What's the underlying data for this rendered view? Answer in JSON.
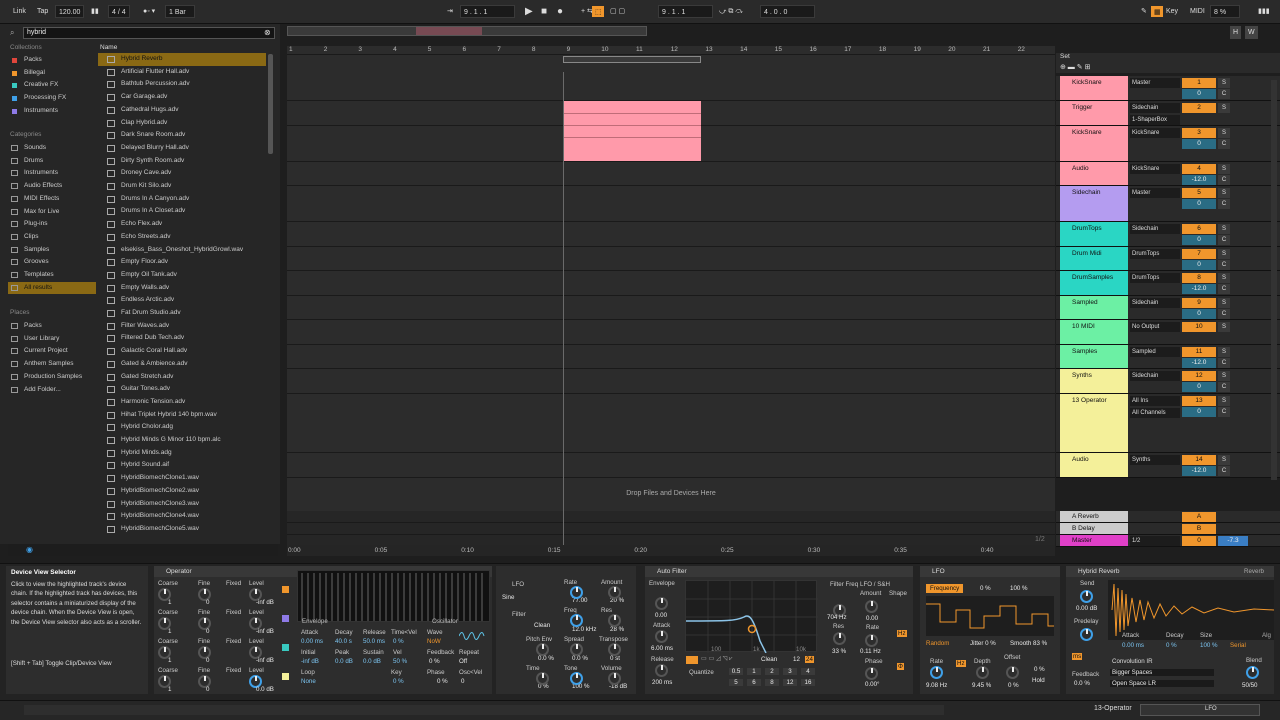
{
  "topbar": {
    "link": "Link",
    "tap": "Tap",
    "tempo": "120.00",
    "signature": "4 / 4",
    "quantize": "1 Bar",
    "position": "9 .  1 .  1",
    "loop_start": "9 .  1 .  1",
    "loop_length": "4 .  0 .  0",
    "key": "Key",
    "midi": "MIDI",
    "cpu": "8 %",
    "h": "H",
    "w": "W"
  },
  "browser": {
    "search_value": "hybrid",
    "collections_title": "Collections",
    "collections": [
      {
        "label": "Packs",
        "color": "#e0463c"
      },
      {
        "label": "Billegal",
        "color": "#f0962c"
      },
      {
        "label": "Creative FX",
        "color": "#39c9c0"
      },
      {
        "label": "Processing FX",
        "color": "#3fa0e8"
      },
      {
        "label": "Instruments",
        "color": "#8e7ae6"
      }
    ],
    "categories_title": "Categories",
    "categories": [
      "Sounds",
      "Drums",
      "Instruments",
      "Audio Effects",
      "MIDI Effects",
      "Max for Live",
      "Plug-ins",
      "Clips",
      "Samples",
      "Grooves",
      "Templates",
      "All results"
    ],
    "places_title": "Places",
    "places": [
      "Packs",
      "User Library",
      "Current Project",
      "Anthem Samples",
      "Production Samples",
      "Add Folder..."
    ],
    "name_header": "Name",
    "files": [
      "Hybrid Reverb",
      "Artificial Flutter Hall.adv",
      "Bathtub Percussion.adv",
      "Car Garage.adv",
      "Cathedral Hugs.adv",
      "Clap Hybrid.adv",
      "Dark Snare Room.adv",
      "Delayed Blurry Hall.adv",
      "Dirty Synth Room.adv",
      "Droney Cave.adv",
      "Drum Kit Silo.adv",
      "Drums In A Canyon.adv",
      "Drums In A Closet.adv",
      "Echo Flex.adv",
      "Echo Streets.adv",
      "elsekiss_Bass_Oneshot_HybridGrowl.wav",
      "Empty Floor.adv",
      "Empty Oil Tank.adv",
      "Empty Walls.adv",
      "Endless Arctic.adv",
      "Fat Drum Studio.adv",
      "Filter Waves.adv",
      "Filtered Dub Tech.adv",
      "Galactic Coral Hall.adv",
      "Gated & Ambience.adv",
      "Gated Stretch.adv",
      "Guitar Tones.adv",
      "Harmonic Tension.adv",
      "Hihat Triplet Hybrid 140 bpm.wav",
      "Hybrid Cholor.adg",
      "Hybrid Minds G Minor 110 bpm.alc",
      "Hybrid Minds.adg",
      "Hybrid Sound.aif",
      "HybridBiomechClone1.wav",
      "HybridBiomechClone2.wav",
      "HybridBiomechClone3.wav",
      "HybridBiomechClone4.wav",
      "HybridBiomechClone5.wav"
    ]
  },
  "arrangement": {
    "ruler": [
      "1",
      "2",
      "3",
      "4",
      "5",
      "6",
      "7",
      "8",
      "9",
      "10",
      "11",
      "12",
      "13",
      "14",
      "15",
      "16",
      "17",
      "18",
      "19",
      "20",
      "21",
      "22"
    ],
    "time": [
      "0:00",
      "0:05",
      "0:10",
      "0:15",
      "0:20",
      "0:25",
      "0:30",
      "0:35",
      "0:40"
    ],
    "drop_text": "Drop Files and Devices Here",
    "set_label": "Set",
    "zoom": "1/2"
  },
  "tracks": [
    {
      "name": "KickSnare",
      "color": "#ff9aaa",
      "io": "Master",
      "num": "1",
      "vol": "0",
      "h": 25
    },
    {
      "name": "Trigger",
      "color": "#ff9aaa",
      "io": "Sidechain",
      "io2": "1-ShaperBox",
      "num": "2",
      "vol": "",
      "h": 25
    },
    {
      "name": "KickSnare",
      "color": "#ff9aaa",
      "io": "KickSnare",
      "num": "3",
      "vol": "0",
      "h": 36
    },
    {
      "name": "Audio",
      "color": "#ff9aaa",
      "io": "KickSnare",
      "num": "4",
      "vol": "-12.0",
      "h": 24
    },
    {
      "name": "Sidechain",
      "color": "#b49cf0",
      "io": "Master",
      "num": "5",
      "vol": "0",
      "h": 36
    },
    {
      "name": "DrumTops",
      "color": "#2ad6c4",
      "io": "Sidechain",
      "num": "6",
      "vol": "0",
      "h": 25
    },
    {
      "name": "Drum Midi",
      "color": "#2ad6c4",
      "io": "DrumTops",
      "num": "7",
      "vol": "0",
      "h": 24
    },
    {
      "name": "DrumSamples",
      "color": "#2ad6c4",
      "io": "DrumTops",
      "num": "8",
      "vol": "-12.0",
      "h": 25
    },
    {
      "name": "Sampled",
      "color": "#6cf0a4",
      "io": "Sidechain",
      "num": "9",
      "vol": "0",
      "h": 24
    },
    {
      "name": "10 MIDI",
      "color": "#6cf0a4",
      "io": "No Output",
      "num": "10",
      "vol": "",
      "h": 25
    },
    {
      "name": "Samples",
      "color": "#6cf0a4",
      "io": "Sampled",
      "num": "11",
      "vol": "-12.0",
      "h": 24
    },
    {
      "name": "Synths",
      "color": "#f4f09a",
      "io": "Sidechain",
      "num": "12",
      "vol": "0",
      "h": 25
    },
    {
      "name": "13 Operator",
      "color": "#f4f09a",
      "io": "All Ins",
      "io2": "All Channels",
      "num": "13",
      "vol": "0",
      "h": 59
    },
    {
      "name": "Audio",
      "color": "#f4f09a",
      "io": "Synths",
      "num": "14",
      "vol": "-12.0",
      "h": 25
    }
  ],
  "returns": [
    {
      "name": "A Reverb",
      "num": "A",
      "color": "#cccccc"
    },
    {
      "name": "B Delay",
      "num": "B",
      "color": "#cccccc"
    },
    {
      "name": "Master",
      "num": "0",
      "vol": "-7.3",
      "io": "1/2",
      "color": "#e040c8"
    }
  ],
  "info": {
    "title": "Device View Selector",
    "body": "Click to view the highlighted track's device chain. If the highlighted track has devices, this selector contains a miniaturized display of the device chain. When the Device View is open, the Device View selector also acts as a scroller.",
    "shortcut": "[Shift + Tab] Toggle Clip/Device View"
  },
  "operator": {
    "title": "Operator",
    "rows": [
      {
        "coarse": "1",
        "fine": "0",
        "level": "-inf dB"
      },
      {
        "coarse": "1",
        "fine": "0",
        "level": "-inf dB"
      },
      {
        "coarse": "1",
        "fine": "0",
        "level": "-inf dB"
      },
      {
        "coarse": "1",
        "fine": "0",
        "level": "0.0 dB"
      }
    ],
    "labels": {
      "coarse": "Coarse",
      "fine": "Fine",
      "fixed": "Fixed",
      "level": "Level"
    },
    "env": {
      "envelope": "Envelope",
      "oscillator": "Oscillator",
      "attack": "Attack",
      "decay": "Decay",
      "release": "Release",
      "timevel": "Time<Vel",
      "wave": "Wave",
      "initial": "Initial",
      "peak": "Peak",
      "sustain": "Sustain",
      "vel": "Vel",
      "feedback": "Feedback",
      "repeat": "Repeat",
      "loop": "Loop",
      "key": "Key",
      "phase": "Phase",
      "oscvel": "Osc<Vel",
      "attack_v": "0.00 ms",
      "decay_v": "40.0 s",
      "release_v": "50.0 ms",
      "timevel_v": "0 %",
      "wave_v": "NoW",
      "initial_v": "-inf dB",
      "peak_v": "0.0 dB",
      "sustain_v": "0.0 dB",
      "vel_v": "50 %",
      "feedback_v": "0 %",
      "repeat_v": "Off",
      "loop_v": "None",
      "key_v": "0 %",
      "phase_v": "0 %",
      "oscvel_v": "0"
    }
  },
  "lfo_panel": {
    "lfo": "LFO",
    "shape": "Sine",
    "rate": "Rate",
    "rate_v": "77.00",
    "amount": "Amount",
    "amount_v": "20 %",
    "filter": "Filter",
    "freq": "Freq",
    "freq_v": "12.0 kHz",
    "res": "Res",
    "res_v": "28 %",
    "clean": "Clean",
    "pitchenv": "Pitch Env",
    "pitchenv_v": "0.0 %",
    "spread": "Spread",
    "spread_v": "0.0 %",
    "transpose": "Transpose",
    "transpose_v": "0 st",
    "time": "Time",
    "time_v": "0 %",
    "tone": "Tone",
    "tone_v": "100 %",
    "volume": "Volume",
    "volume_v": "-18 dB"
  },
  "autofilter": {
    "title": "Auto Filter",
    "envelope": "Envelope",
    "env_v": "0.00",
    "attack": "Attack",
    "attack_v": "6.00 ms",
    "release": "Release",
    "release_v": "200 ms",
    "filter_freq": "Filter Freq",
    "freq_v": "704 Hz",
    "res": "Res",
    "res_v": "33 %",
    "lfo": "LFO / S&H",
    "amount": "Amount",
    "amount_v": "0.00",
    "shape": "Shape",
    "rate": "Rate",
    "rate_v": "0.11 Hz",
    "phase": "Phase",
    "phase_v": "0.00°",
    "quantize": "Quantize",
    "clean": "Clean",
    "g1": "100",
    "g2": "1k",
    "g3": "10k",
    "q_values": [
      "0.5",
      "1",
      "2",
      "3",
      "4",
      "5",
      "6",
      "8",
      "12",
      "16"
    ],
    "n12": "12",
    "n24": "24"
  },
  "lfo_device": {
    "title": "LFO",
    "target": "Frequency",
    "t1": "0 %",
    "t2": "100 %",
    "mode": "Random",
    "jitter": "Jitter 0 %",
    "smooth": "Smooth 83 %",
    "rate": "Rate",
    "rate_v": "9.08 Hz",
    "depth": "Depth",
    "depth_v": "9.45 %",
    "offset": "Offset",
    "offset_v": "0 %",
    "pct": "0 %",
    "hz": "Hz",
    "hold": "Hold"
  },
  "hybrid_reverb": {
    "title": "Hybrid Reverb",
    "reverb_btn": "Reverb",
    "send": "Send",
    "send_v": "0.00 dB",
    "predelay": "Predelay",
    "predelay_v": "0.00 ms",
    "feedback": "Feedback",
    "feedback_v": "0.0 %",
    "attack": "Attack",
    "decay": "Decay",
    "size": "Size",
    "attack_v": "0.00 ms",
    "decay_v": "0 %",
    "size_v": "100 %",
    "serial": "Serial",
    "algo": "Alg",
    "convolution": "Convolution IR",
    "ir1": "Bigger Spaces",
    "ir2": "Open Space LR",
    "blend": "Blend",
    "blend_v": "50/50",
    "ms": "ms"
  },
  "statusbar": {
    "track": "13-Operator",
    "lfo": "LFO"
  }
}
